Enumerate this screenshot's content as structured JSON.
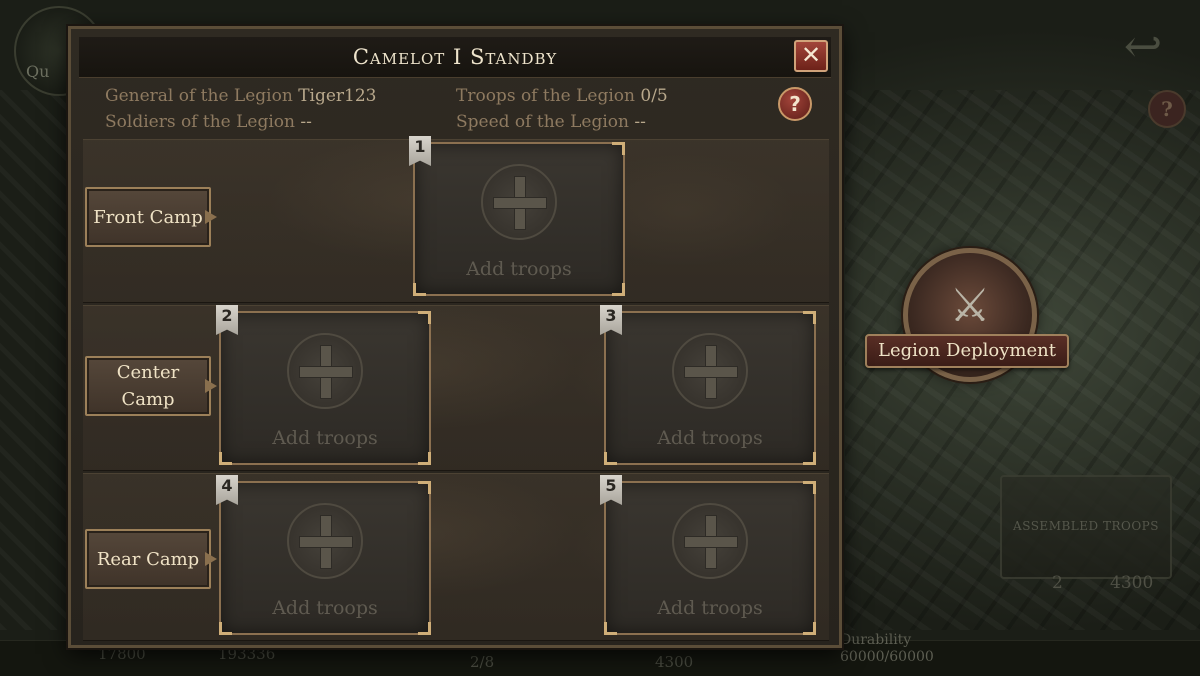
{
  "background": {
    "top_left_text": "Qu",
    "back_icon": "back-arrow-icon",
    "help_icon_label": "?",
    "legion_deployment": {
      "label": "Legion Deployment",
      "icon": "knight-shield-icon"
    },
    "assembled_troops": {
      "label": "ASSEMBLED TROOPS",
      "count": "2",
      "power": "4300"
    },
    "bottom_bar": {
      "resource_1": "17800",
      "resource_2": "193336",
      "troops": "2/8",
      "power": "4300",
      "durability_label": "Durability",
      "durability_value": "60000/60000"
    }
  },
  "modal": {
    "title": "Camelot I Standby",
    "close_icon": "close-icon",
    "help_label": "?",
    "info": {
      "general_label": "General of the Legion",
      "general_value": "Tiger123",
      "soldiers_label": "Soldiers of the Legion",
      "soldiers_value": "--",
      "troops_label": "Troops of the Legion",
      "troops_value": "0/5",
      "speed_label": "Speed of the Legion",
      "speed_value": "--"
    },
    "camps": [
      {
        "label": "Front Camp"
      },
      {
        "label": "Center Camp"
      },
      {
        "label": "Rear Camp"
      }
    ],
    "slots": [
      {
        "number": "1",
        "text": "Add troops"
      },
      {
        "number": "2",
        "text": "Add troops"
      },
      {
        "number": "3",
        "text": "Add troops"
      },
      {
        "number": "4",
        "text": "Add troops"
      },
      {
        "number": "5",
        "text": "Add troops"
      }
    ]
  }
}
